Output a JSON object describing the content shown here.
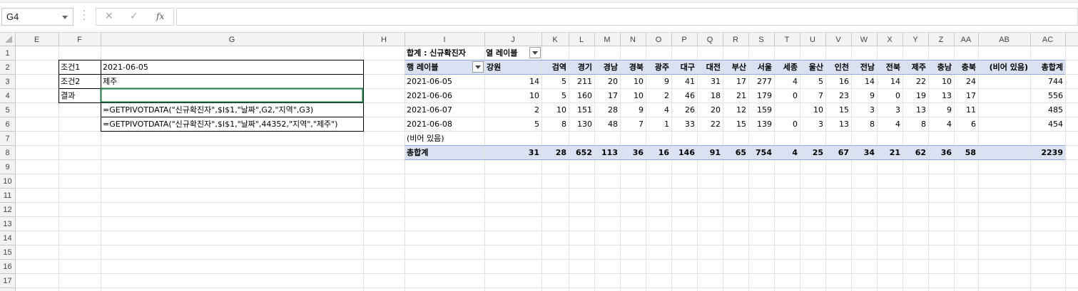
{
  "name_box": "G4",
  "formula_bar": {
    "cancel_icon": "✕",
    "enter_icon": "✓",
    "fx_label": "fx",
    "formula": ""
  },
  "columns": [
    "E",
    "F",
    "G",
    "H",
    "I",
    "J",
    "K",
    "L",
    "M",
    "N",
    "O",
    "P",
    "Q",
    "R",
    "S",
    "T",
    "U",
    "V",
    "W",
    "X",
    "Y",
    "Z",
    "AA",
    "AB",
    "AC"
  ],
  "rows": [
    "1",
    "2",
    "3",
    "4",
    "5",
    "6",
    "7",
    "8",
    "9",
    "10",
    "11",
    "12",
    "13",
    "14",
    "15",
    "16",
    "17"
  ],
  "left_table": {
    "r2": {
      "label": "조건1",
      "value": "2021-06-05"
    },
    "r3": {
      "label": "조건2",
      "value": "제주"
    },
    "r4": {
      "label": "결과",
      "value": ""
    },
    "r5": {
      "value": "=GETPIVOTDATA(\"신규확진자\",$I$1,\"날짜\",G2,\"지역\",G3)"
    },
    "r6": {
      "value": "=GETPIVOTDATA(\"신규확진자\",$I$1,\"날짜\",44352,\"지역\",\"제주\")"
    }
  },
  "pivot": {
    "value_label": "합계 : 신규확진자",
    "col_label": "열 레이블",
    "row_label": "행 레이블",
    "headers": [
      "강원",
      "검역",
      "경기",
      "경남",
      "경북",
      "광주",
      "대구",
      "대전",
      "부산",
      "서울",
      "세종",
      "울산",
      "인천",
      "전남",
      "전북",
      "제주",
      "충남",
      "충북",
      "(비어 있음)",
      "총합계"
    ],
    "rows": [
      {
        "label": "2021-06-05",
        "values": [
          "14",
          "5",
          "211",
          "20",
          "10",
          "9",
          "41",
          "31",
          "17",
          "277",
          "4",
          "5",
          "16",
          "14",
          "14",
          "22",
          "10",
          "24",
          "",
          "744"
        ]
      },
      {
        "label": "2021-06-06",
        "values": [
          "10",
          "5",
          "160",
          "17",
          "10",
          "2",
          "46",
          "18",
          "21",
          "179",
          "0",
          "7",
          "23",
          "9",
          "0",
          "19",
          "13",
          "17",
          "",
          "556"
        ]
      },
      {
        "label": "2021-06-07",
        "values": [
          "2",
          "10",
          "151",
          "28",
          "9",
          "4",
          "26",
          "20",
          "12",
          "159",
          "",
          "10",
          "15",
          "3",
          "3",
          "13",
          "9",
          "11",
          "",
          "485"
        ]
      },
      {
        "label": "2021-06-08",
        "values": [
          "5",
          "8",
          "130",
          "48",
          "7",
          "1",
          "33",
          "22",
          "15",
          "139",
          "0",
          "3",
          "13",
          "8",
          "4",
          "8",
          "4",
          "6",
          "",
          "454"
        ]
      },
      {
        "label": "(비어 있음)",
        "values": [
          "",
          "",
          "",
          "",
          "",
          "",
          "",
          "",
          "",
          "",
          "",
          "",
          "",
          "",
          "",
          "",
          "",
          "",
          "",
          ""
        ]
      }
    ],
    "total": {
      "label": "총합계",
      "values": [
        "31",
        "28",
        "652",
        "113",
        "36",
        "16",
        "146",
        "91",
        "65",
        "754",
        "4",
        "25",
        "67",
        "34",
        "21",
        "62",
        "36",
        "58",
        "",
        "2239"
      ]
    }
  },
  "colors": {
    "pivot_header_bg": "#d9e1f2",
    "pivot_border": "#8ea9db",
    "header_bg": "#f3f3f3",
    "gridline": "#e1e1e1",
    "header_border": "#c8c8c8"
  }
}
